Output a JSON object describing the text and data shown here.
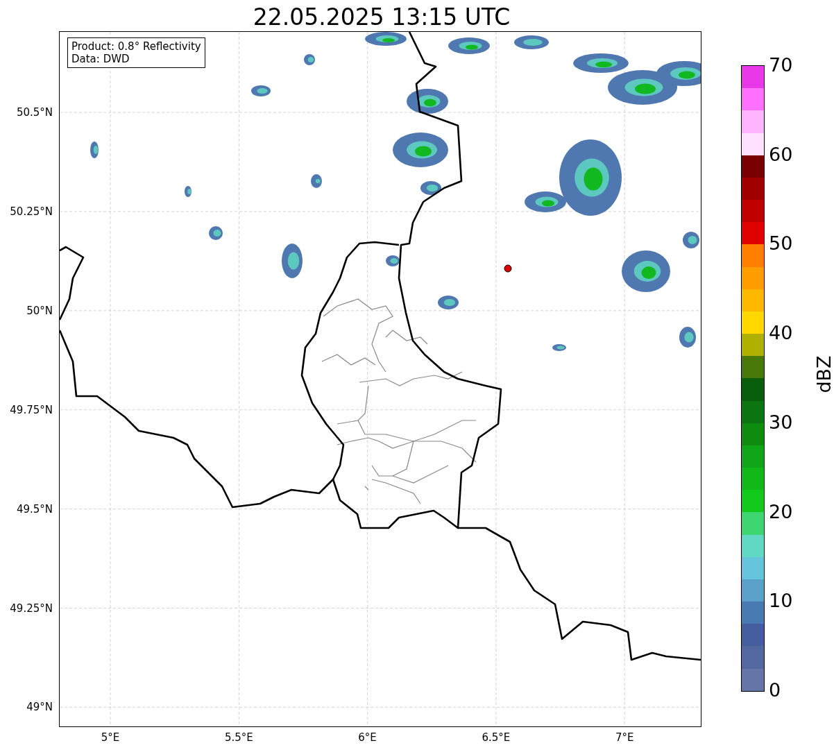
{
  "title": "22.05.2025 13:15 UTC",
  "map": {
    "annotation": [
      "Product: 0.8° Reflectivity",
      "Data: DWD"
    ],
    "y_ticks": [
      "50.5°N",
      "50.25°N",
      "50°N",
      "49.75°N",
      "49.5°N",
      "49.25°N",
      "49°N"
    ],
    "x_ticks": [
      "5°E",
      "5.5°E",
      "6°E",
      "6.5°E",
      "7°E"
    ]
  },
  "colorbar": {
    "label": "dBZ",
    "ticks": [
      "70",
      "60",
      "50",
      "40",
      "30",
      "20",
      "10",
      "0"
    ],
    "bands": [
      {
        "color": "#6476a8"
      },
      {
        "color": "#5468a0"
      },
      {
        "color": "#445ea0"
      },
      {
        "color": "#4a7ab2"
      },
      {
        "color": "#5aa0c8"
      },
      {
        "color": "#64c4dc"
      },
      {
        "color": "#60d8c4"
      },
      {
        "color": "#3ed670"
      },
      {
        "color": "#12c81a"
      },
      {
        "color": "#10b818"
      },
      {
        "color": "#10a418"
      },
      {
        "color": "#0e8c10"
      },
      {
        "color": "#0c7410"
      },
      {
        "color": "#085e0c"
      },
      {
        "color": "#487808"
      },
      {
        "color": "#b0b000"
      },
      {
        "color": "#ffd800"
      },
      {
        "color": "#ffb800"
      },
      {
        "color": "#ff9c00"
      },
      {
        "color": "#ff8000"
      },
      {
        "color": "#e00000"
      },
      {
        "color": "#c00000"
      },
      {
        "color": "#a00000"
      },
      {
        "color": "#780000"
      },
      {
        "color": "#ffe0ff"
      },
      {
        "color": "#ffb4ff"
      },
      {
        "color": "#ff70ff"
      },
      {
        "color": "#e838e8"
      }
    ]
  }
}
